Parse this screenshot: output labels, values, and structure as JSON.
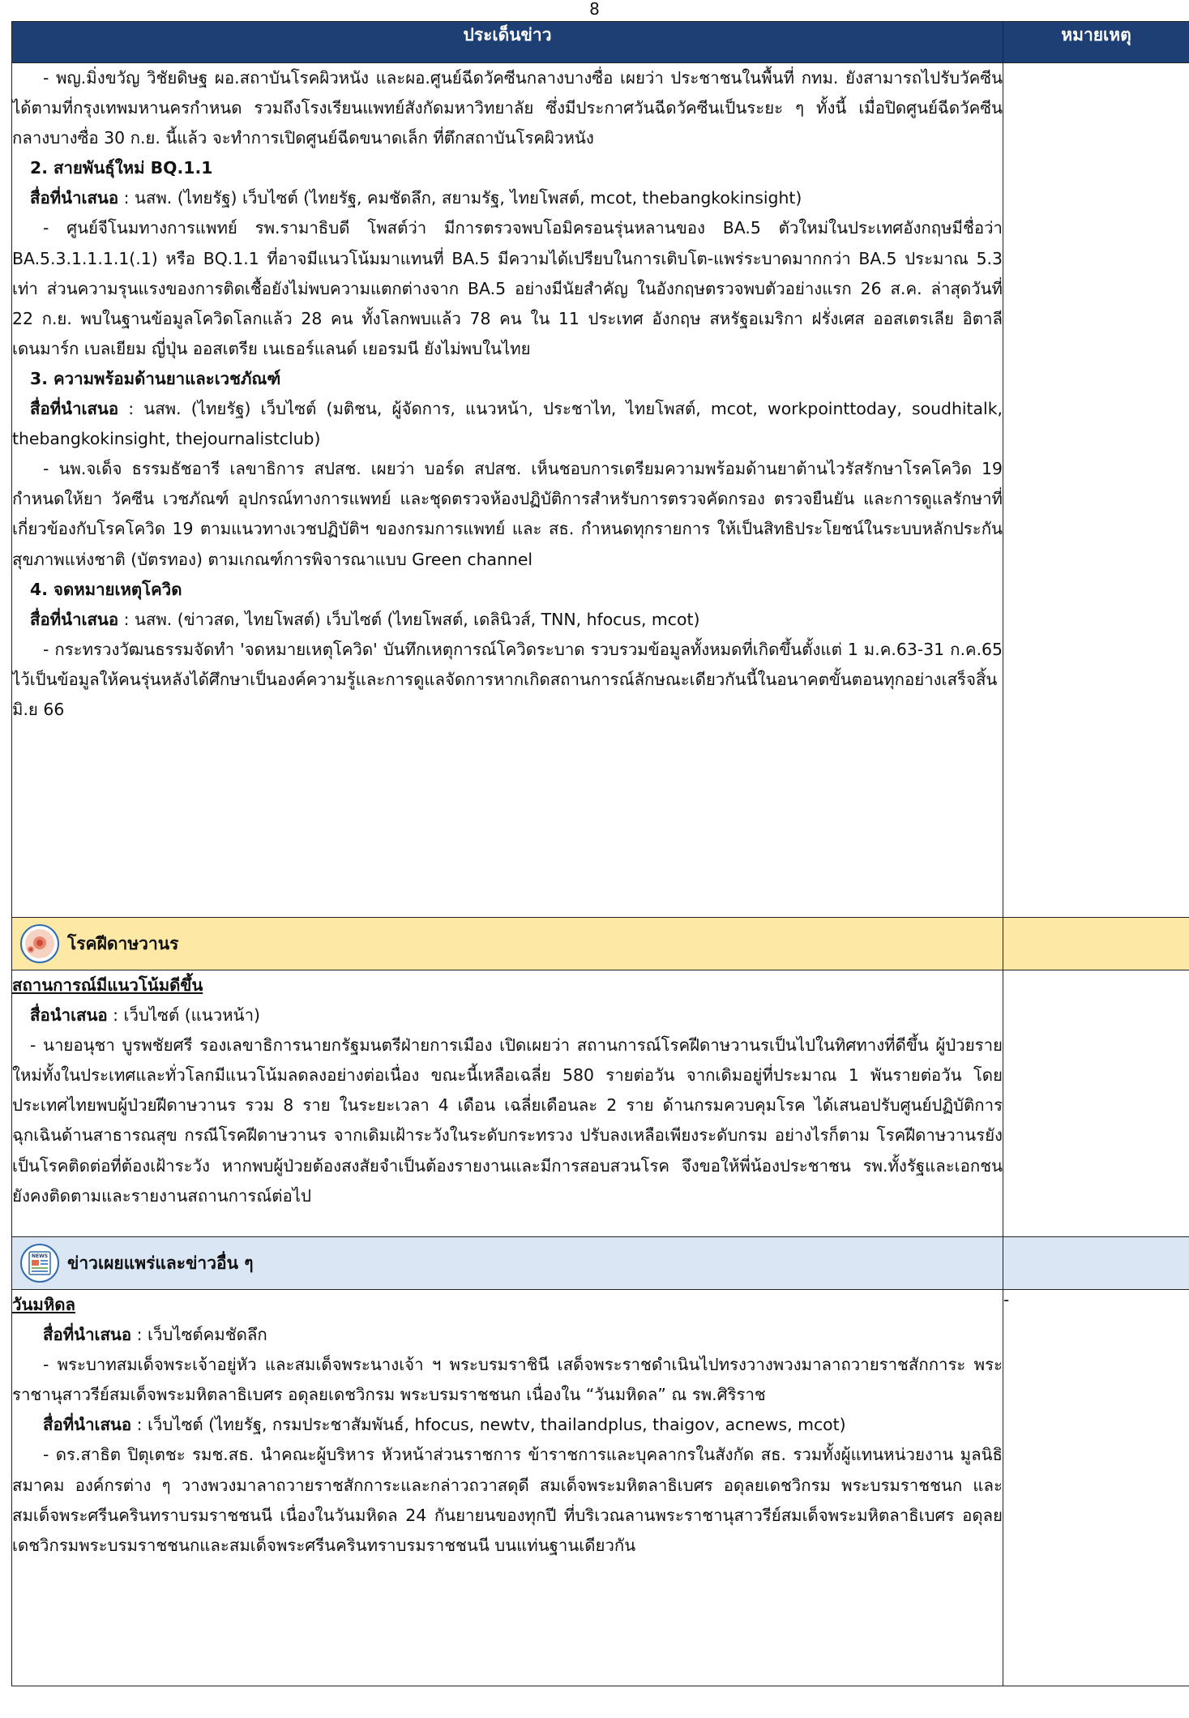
{
  "page": {
    "number": "8"
  },
  "header": {
    "topic_col": "ประเด็นข่าว",
    "note_col": "หมายเหตุ"
  },
  "covid_continued": {
    "intro": "- พญ.มิ่งขวัญ วิชัยดิษฐ ผอ.สถาบันโรคผิวหนัง และผอ.ศูนย์ฉีดวัคซีนกลางบางซื่อ เผยว่า ประชาชนในพื้นที่ กทม. ยังสามารถไปรับวัคซีนได้ตามที่กรุงเทพมหานครกำหนด รวมถึงโรงเรียนแพทย์สังกัดมหาวิทยาลัย ซึ่งมีประกาศวันฉีดวัคซีนเป็นระยะ ๆ ทั้งนี้ เมื่อปิดศูนย์ฉีดวัคซีนกลางบางซื่อ 30 ก.ย. นี้แล้ว จะทำการเปิดศูนย์ฉีดขนาดเล็ก ที่ตึกสถาบันโรคผิวหนัง",
    "sections": [
      {
        "title": "2. สายพันธุ์ใหม่ BQ.1.1",
        "source_label": "สื่อที่นำเสนอ",
        "source_text": " : นสพ. (ไทยรัฐ) เว็บไซต์ (ไทยรัฐ, คมชัดลึก, สยามรัฐ, ไทยโพสต์, mcot, thebangkokinsight)",
        "body": "- ศูนย์จีโนมทางการแพทย์ รพ.รามาธิบดี โพสต์ว่า มีการตรวจพบโอมิครอนรุ่นหลานของ BA.5 ตัวใหม่ในประเทศอังกฤษมีชื่อว่า BA.5.3.1.1.1.1(.1) หรือ BQ.1.1 ที่อาจมีแนวโน้มมาแทนที่ BA.5 มีความได้เปรียบในการเติบโต-แพร่ระบาดมากกว่า BA.5 ประมาณ 5.3 เท่า ส่วนความรุนแรงของการติดเชื้อยังไม่พบความแตกต่างจาก BA.5 อย่างมีนัยสำคัญ ในอังกฤษตรวจพบตัวอย่างแรก 26 ส.ค. ล่าสุดวันที่ 22 ก.ย. พบในฐานข้อมูลโควิดโลกแล้ว 28 คน ทั้งโลกพบแล้ว 78 คน ใน 11 ประเทศ อังกฤษ สหรัฐอเมริกา ฝรั่งเศส ออสเตรเลีย อิตาลี เดนมาร์ก เบลเยียม ญี่ปุ่น ออสเตรีย เนเธอร์แลนด์ เยอรมนี ยังไม่พบในไทย"
      },
      {
        "title": "3. ความพร้อมด้านยาและเวชภัณฑ์",
        "source_label": "สื่อที่นำเสนอ",
        "source_text": " : นสพ. (ไทยรัฐ) เว็บไซต์ (มติชน, ผู้จัดการ, แนวหน้า, ประชาไท, ไทยโพสต์, mcot, workpointtoday, soudhitalk, thebangkokinsight, thejournalistclub)",
        "body": "- นพ.จเด็จ ธรรมธัชอารี เลขาธิการ สปสช. เผยว่า บอร์ด สปสช. เห็นชอบการเตรียมความพร้อมด้านยาต้านไวรัสรักษาโรคโควิด 19 กำหนดให้ยา วัคซีน เวชภัณฑ์ อุปกรณ์ทางการแพทย์ และชุดตรวจห้องปฏิบัติการสำหรับการตรวจคัดกรอง ตรวจยืนยัน และการดูแลรักษาที่เกี่ยวข้องกับโรคโควิด 19 ตามแนวทางเวชปฏิบัติฯ ของกรมการแพทย์ และ สธ. กำหนดทุกรายการ ให้เป็นสิทธิประโยชน์ในระบบหลักประกันสุขภาพแห่งชาติ (บัตรทอง) ตามเกณฑ์การพิจารณาแบบ Green channel"
      },
      {
        "title": "4. จดหมายเหตุโควิด",
        "source_label": "สื่อที่นำเสนอ",
        "source_text": " : นสพ. (ข่าวสด, ไทยโพสต์) เว็บไซต์ (ไทยโพสต์, เดลินิวส์, TNN, hfocus, mcot)",
        "body": "- กระทรวงวัฒนธรรมจัดทำ 'จดหมายเหตุโควิด' บันทึกเหตุการณ์โควิดระบาด รวบรวมข้อมูลทั้งหมดที่เกิดขึ้นตั้งแต่ 1 ม.ค.63-31 ก.ค.65 ไว้เป็นข้อมูลให้คนรุ่นหลังได้ศึกษาเป็นองค์ความรู้และการดูแลจัดการหากเกิดสถานการณ์ลักษณะเดียวกันนี้ในอนาคตขั้นตอนทุกอย่างเสร็จสิ้น มิ.ย 66"
      }
    ]
  },
  "monkeypox": {
    "band_title": "โรคฝีดาษวานร",
    "topic": "สถานการณ์มีแนวโน้มดีขึ้น",
    "source_label": "สื่อนำเสนอ",
    "source_text": "  : เว็บไซต์ (แนวหน้า)",
    "body": "- นายอนุชา บูรพชัยศรี รองเลขาธิการนายกรัฐมนตรีฝ่ายการเมือง เปิดเผยว่า สถานการณ์โรคฝีดาษวานรเป็นไปในทิศทางที่ดีขึ้น ผู้ป่วยรายใหม่ทั้งในประเทศและทั่วโลกมีแนวโน้มลดลงอย่างต่อเนื่อง ขณะนี้เหลือเฉลี่ย 580 รายต่อวัน จากเดิมอยู่ที่ประมาณ 1 พันรายต่อวัน โดยประเทศไทยพบผู้ป่วยฝีดาษวานร รวม 8 ราย ในระยะเวลา 4 เดือน เฉลี่ยเดือนละ 2 ราย ด้านกรมควบคุมโรค ได้เสนอปรับศูนย์ปฏิบัติการฉุกเฉินด้านสาธารณสุข กรณีโรคฝีดาษวานร จากเดิมเฝ้าระวังในระดับกระทรวง ปรับลงเหลือเพียงระดับกรม อย่างไรก็ตาม โรคฝีดาษวานรยังเป็นโรคติดต่อที่ต้องเฝ้าระวัง หากพบผู้ป่วยต้องสงสัยจำเป็นต้องรายงานและมีการสอบสวนโรค จึงขอให้พี่น้องประชาชน รพ.ทั้งรัฐและเอกชน ยังคงติดตามและรายงานสถานการณ์ต่อไป"
  },
  "other_news": {
    "band_title": "ข่าวเผยแพร่และข่าวอื่น ๆ",
    "icon_text": "NEWS",
    "topic": "วันมหิดล",
    "note": "-",
    "source1_label": "สื่อที่นำเสนอ",
    "source1_text": " : เว็บไซต์คมชัดลึก",
    "body1": "- พระบาทสมเด็จพระเจ้าอยู่หัว และสมเด็จพระนางเจ้า ฯ พระบรมราชินี เสด็จพระราชดำเนินไปทรงวางพวงมาลาถวายราชสักการะ พระราชานุสาวรีย์สมเด็จพระมหิตลาธิเบศร อดุลยเดชวิกรม พระบรมราชชนก เนื่องใน “วันมหิดล” ณ รพ.ศิริราช",
    "source2_label": "สื่อที่นำเสนอ",
    "source2_text": " : เว็บไซต์ (ไทยรัฐ, กรมประชาสัมพันธ์, hfocus, newtv, thailandplus, thaigov, acnews, mcot)",
    "body2": "- ดร.สาธิต ปิตุเตชะ รมช.สธ. นำคณะผู้บริหาร หัวหน้าส่วนราชการ ข้าราชการและบุคลากรในสังกัด สธ. รวมทั้งผู้แทนหน่วยงาน มูลนิธิ สมาคม องค์กรต่าง ๆ วางพวงมาลาถวายราชสักการะและกล่าวถวาสดุดี สมเด็จพระมหิตลาธิเบศร อดุลยเดชวิกรม พระบรมราชชนก และสมเด็จพระศรีนครินทราบรมราชชนนี เนื่องในวันมหิดล 24 กันยายนของทุกปี ที่บริเวณลานพระราชานุสาวรีย์สมเด็จพระมหิตลาธิเบศร อดุลยเดชวิกรมพระบรมราชชนกและสมเด็จพระศรีนครินทราบรมราชชนนี บนแท่นฐานเดียวกัน"
  }
}
